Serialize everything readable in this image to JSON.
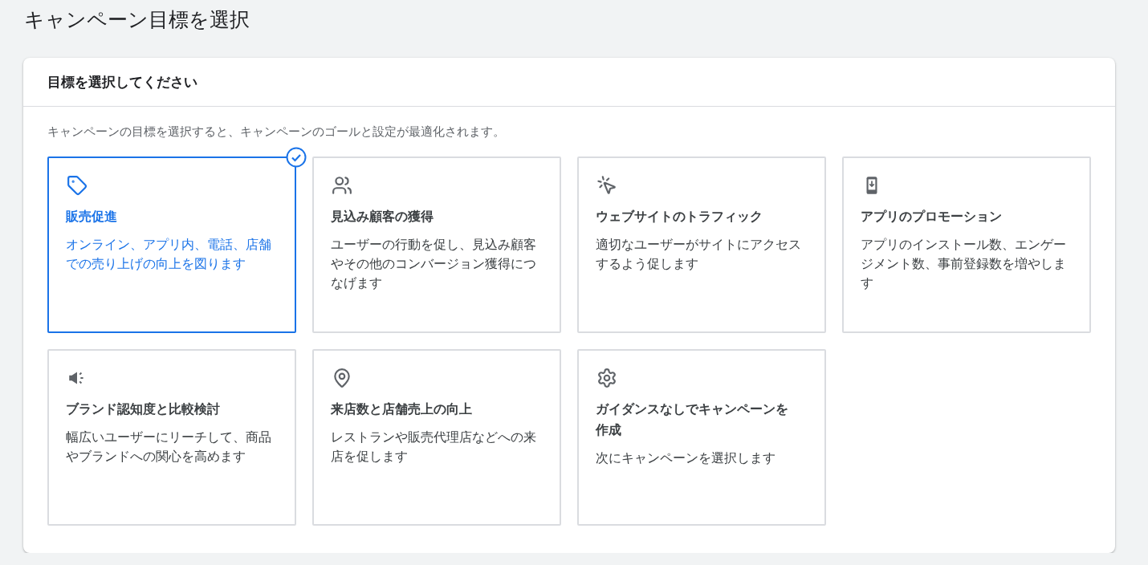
{
  "page_title": "キャンペーン目標を選択",
  "card": {
    "title": "目標を選択してください",
    "description": "キャンペーンの目標を選択すると、キャンペーンのゴールと設定が最適化されます。",
    "goals": [
      {
        "title": "販売促進",
        "description": "オンライン、アプリ内、電話、店舗での売り上げの向上を図ります",
        "selected": true
      },
      {
        "title": "見込み顧客の獲得",
        "description": "ユーザーの行動を促し、見込み顧客やその他のコンバージョン獲得につなげます",
        "selected": false
      },
      {
        "title": "ウェブサイトのトラフィック",
        "description": "適切なユーザーがサイトにアクセスするよう促します",
        "selected": false
      },
      {
        "title": "アプリのプロモーション",
        "description": "アプリのインストール数、エンゲージメント数、事前登録数を増やします",
        "selected": false
      },
      {
        "title": "ブランド認知度と比較検討",
        "description": "幅広いユーザーにリーチして、商品やブランドへの関心を高めます",
        "selected": false
      },
      {
        "title": "来店数と店舗売上の向上",
        "description": "レストランや販売代理店などへの来店を促します",
        "selected": false
      },
      {
        "title": "ガイダンスなしでキャンペーンを作成",
        "description": "次にキャンペーンを選択します",
        "selected": false
      }
    ]
  }
}
